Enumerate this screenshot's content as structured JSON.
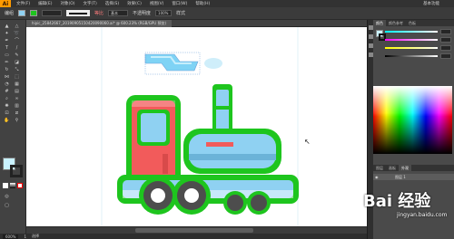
{
  "app": {
    "logo": "Ai"
  },
  "menubar": {
    "items": [
      "文件(F)",
      "编辑(E)",
      "对象(O)",
      "文字(T)",
      "选择(S)",
      "效果(C)",
      "视图(V)",
      "窗口(W)",
      "帮助(H)"
    ],
    "workspace": "基本功能"
  },
  "options_bar": {
    "selection_label": "编组",
    "stroke_weight": "",
    "uniform": "等比",
    "style_label": "基本",
    "opacity_label": "不透明度",
    "opacity_value": "100%",
    "style2": "样式"
  },
  "document": {
    "tab_title": "hipic_25842667_20190905150420090060.ai* @ 600.23% (RGB/GPU 预览)"
  },
  "status": {
    "zoom": "600%",
    "page": "1",
    "tool": "选择"
  },
  "panels": {
    "tabs": [
      "颜色",
      "颜色参考",
      "色板"
    ],
    "layers_tabs": [
      "图层",
      "画板",
      "外观"
    ],
    "layer_name": "图层 1"
  },
  "watermark": {
    "text": "Bai 经验",
    "sub": "jingyan.baidu.com"
  },
  "colors": {
    "accent_green": "#1ec51e",
    "train_red": "#f25b5b",
    "train_blue": "#8fd1f2",
    "wheel_dark": "#4d4d4d"
  }
}
